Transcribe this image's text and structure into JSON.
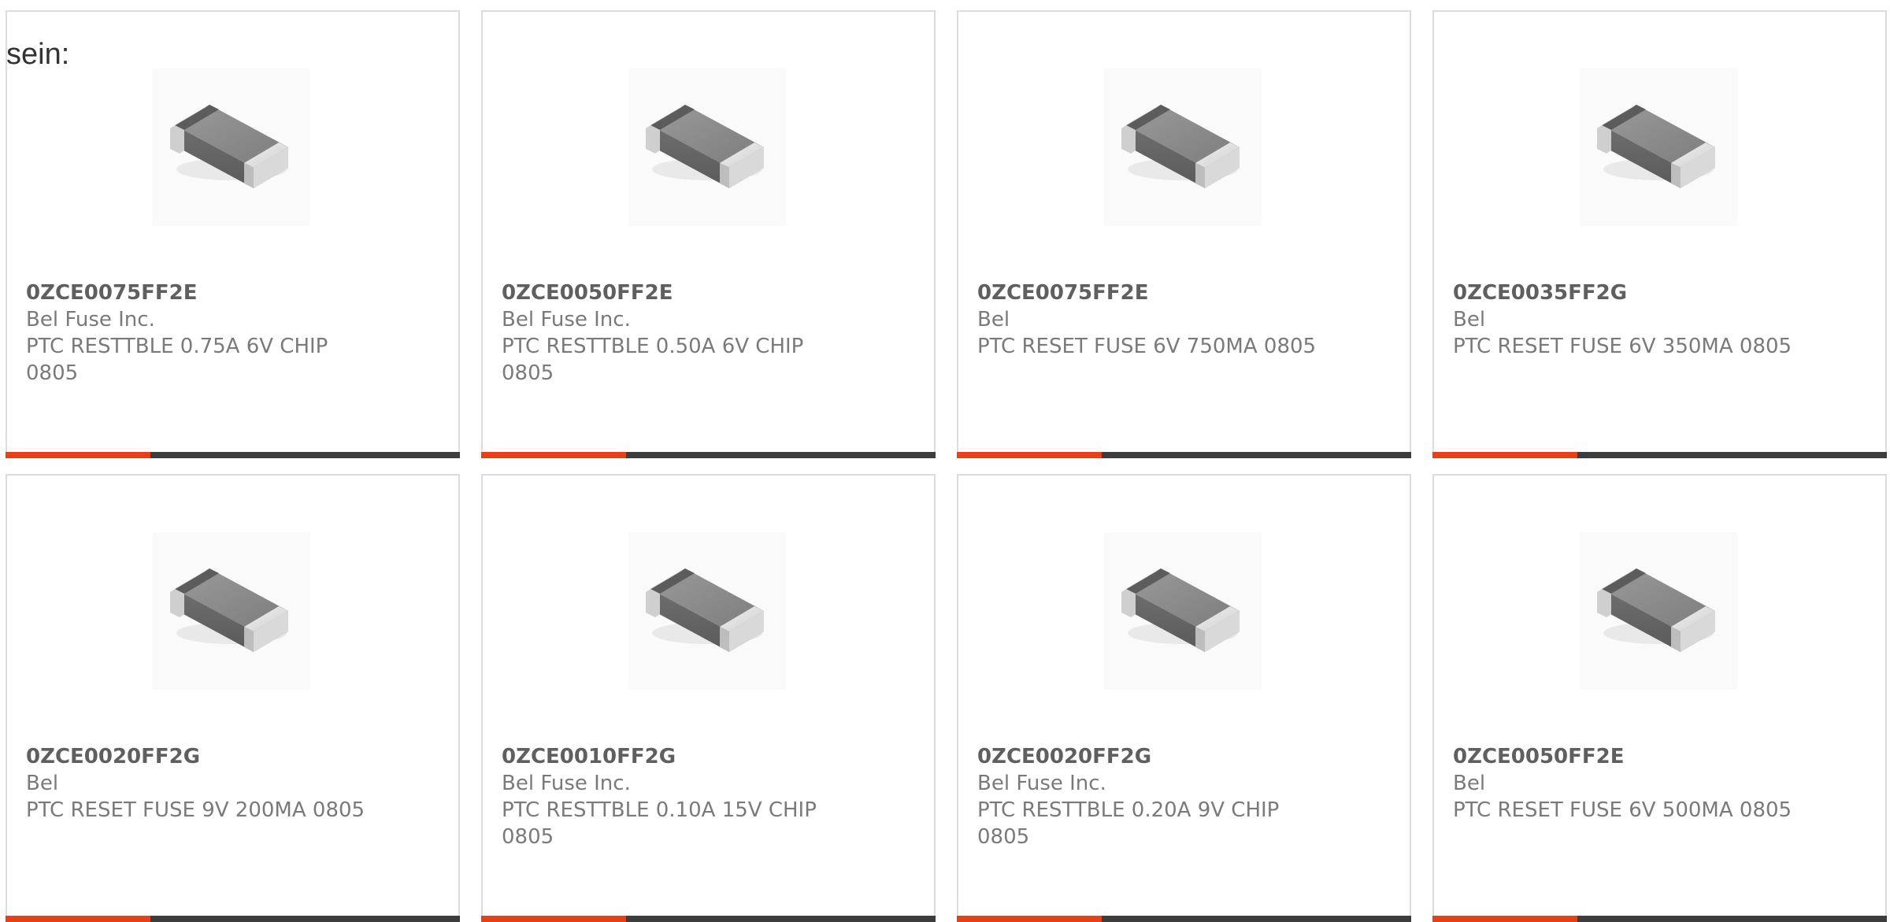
{
  "heading": "sein:",
  "accent_color": "#e2411a",
  "bar_color": "#3c3c3c",
  "product_image_icon": "smd-chip-fuse-icon",
  "products": [
    {
      "part": "0ZCE0075FF2E",
      "manufacturer": "Bel Fuse Inc.",
      "description": "PTC RESTTBLE 0.75A 6V CHIP 0805"
    },
    {
      "part": "0ZCE0050FF2E",
      "manufacturer": "Bel Fuse Inc.",
      "description": "PTC RESTTBLE 0.50A 6V CHIP 0805"
    },
    {
      "part": "0ZCE0075FF2E",
      "manufacturer": "Bel",
      "description": "PTC RESET FUSE 6V 750MA 0805"
    },
    {
      "part": "0ZCE0035FF2G",
      "manufacturer": "Bel",
      "description": "PTC RESET FUSE 6V 350MA 0805"
    },
    {
      "part": "0ZCE0020FF2G",
      "manufacturer": "Bel",
      "description": "PTC RESET FUSE 9V 200MA 0805"
    },
    {
      "part": "0ZCE0010FF2G",
      "manufacturer": "Bel Fuse Inc.",
      "description": "PTC RESTTBLE 0.10A 15V CHIP 0805"
    },
    {
      "part": "0ZCE0020FF2G",
      "manufacturer": "Bel Fuse Inc.",
      "description": "PTC RESTTBLE 0.20A 9V CHIP 0805"
    },
    {
      "part": "0ZCE0050FF2E",
      "manufacturer": "Bel",
      "description": "PTC RESET FUSE 6V 500MA 0805"
    }
  ]
}
